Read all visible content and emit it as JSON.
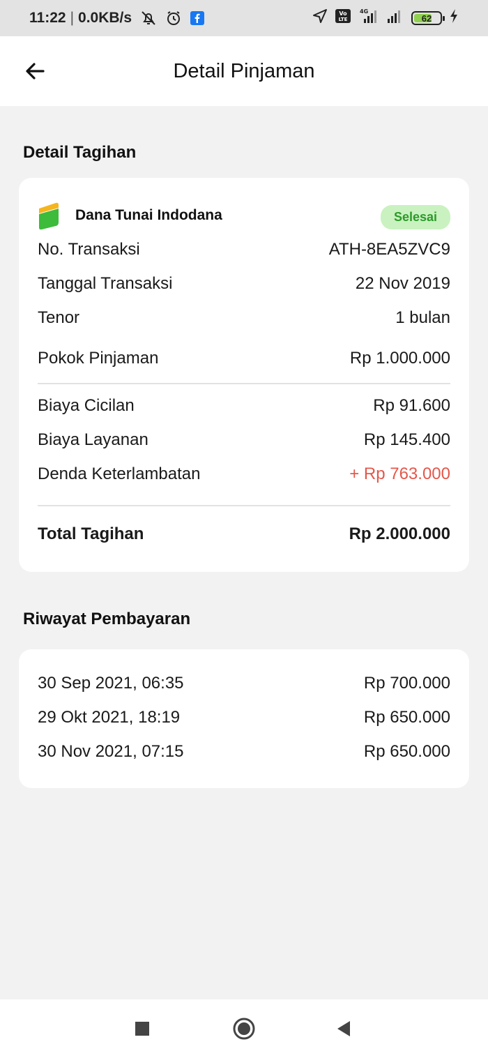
{
  "status_bar": {
    "time": "11:22",
    "network_speed": "0.0KB/s",
    "battery_level": "62",
    "icons": [
      "bell-off-icon",
      "alarm-icon",
      "facebook-icon",
      "location-icon",
      "volte-icon",
      "signal-4g-icon",
      "signal-icon",
      "battery-icon",
      "charging-icon"
    ],
    "volte_label": "Vo LTE",
    "network_type": "4G"
  },
  "app_bar": {
    "title": "Detail Pinjaman",
    "back_icon": "arrow-left-icon"
  },
  "bill_section": {
    "title": "Detail Tagihan",
    "product_name": "Dana Tunai Indodana",
    "status": "Selesai",
    "rows": [
      {
        "label": "No. Transaksi",
        "value": "ATH-8EA5ZVC9"
      },
      {
        "label": "Tanggal Transaksi",
        "value": "22 Nov 2019"
      },
      {
        "label": "Tenor",
        "value": "1 bulan"
      },
      {
        "label": "Pokok Pinjaman",
        "value": "Rp 1.000.000"
      }
    ],
    "fees": [
      {
        "label": "Biaya Cicilan",
        "value": "Rp 91.600"
      },
      {
        "label": "Biaya Layanan",
        "value": "Rp 145.400"
      },
      {
        "label": "Denda Keterlambatan",
        "value": "+ Rp 763.000"
      }
    ],
    "total": {
      "label": "Total Tagihan",
      "value": "Rp 2.000.000"
    }
  },
  "payment_section": {
    "title": "Riwayat Pembayaran",
    "payments": [
      {
        "date": "30 Sep 2021, 06:35",
        "amount": "Rp 700.000"
      },
      {
        "date": "29 Okt 2021, 18:19",
        "amount": "Rp 650.000"
      },
      {
        "date": "30 Nov 2021, 07:15",
        "amount": "Rp 650.000"
      }
    ]
  },
  "colors": {
    "accent_green": "#2d9a2a",
    "badge_bg": "#c9f2c0",
    "late_fee_red": "#e4574a",
    "logo_yellow": "#f4b51e",
    "logo_green": "#3dbb3a"
  },
  "nav_bar": {
    "icons": [
      "recents-square-icon",
      "home-circle-icon",
      "back-triangle-icon"
    ]
  }
}
